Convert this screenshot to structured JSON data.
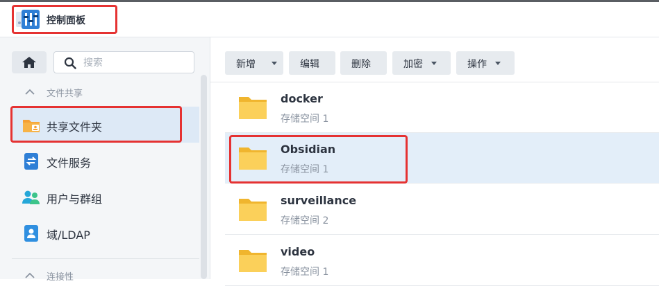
{
  "app": {
    "title": "控制面板"
  },
  "sidebar": {
    "search_placeholder": "搜索",
    "sections": [
      {
        "label": "文件共享"
      },
      {
        "label": "连接性"
      }
    ],
    "items": [
      {
        "label": "共享文件夹",
        "icon": "shared-folder-icon",
        "active": true
      },
      {
        "label": "文件服务",
        "icon": "file-services-icon"
      },
      {
        "label": "用户与群组",
        "icon": "users-group-icon"
      },
      {
        "label": "域/LDAP",
        "icon": "domain-ldap-icon"
      }
    ]
  },
  "toolbar": {
    "buttons": [
      {
        "label": "新增",
        "dropdown": true
      },
      {
        "label": "编辑",
        "dropdown": false
      },
      {
        "label": "删除",
        "dropdown": false
      },
      {
        "label": "加密",
        "dropdown": true
      },
      {
        "label": "操作",
        "dropdown": true
      }
    ]
  },
  "folders": [
    {
      "name": "docker",
      "volume": "存储空间 1"
    },
    {
      "name": "Obsidian",
      "volume": "存储空间 1",
      "selected": true
    },
    {
      "name": "surveillance",
      "volume": "存储空间 2"
    },
    {
      "name": "video",
      "volume": "存储空间 1"
    }
  ],
  "colors": {
    "accent": "#dde9f6",
    "selected_row": "#e3eef9",
    "highlight": "#e53232",
    "folder": "#f5c342"
  }
}
